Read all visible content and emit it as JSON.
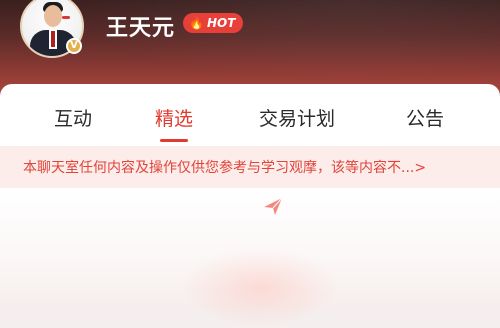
{
  "header": {
    "name": "王天元",
    "hot_badge": {
      "icon": "flame-icon",
      "label": "HOT"
    },
    "verified_icon": "verified-v-icon",
    "verified_label": "V"
  },
  "tabs": [
    {
      "label": "互动",
      "active": false
    },
    {
      "label": "精选",
      "active": true
    },
    {
      "label": "交易计划",
      "active": false
    },
    {
      "label": "公告",
      "active": false
    }
  ],
  "notice": {
    "text": "本聊天室任何内容及操作仅供您参考与学习观摩，该等内容不...>"
  },
  "colors": {
    "accent": "#e23a2e",
    "header_dark": "#3a201f",
    "notice_bg": "#fcecea"
  }
}
